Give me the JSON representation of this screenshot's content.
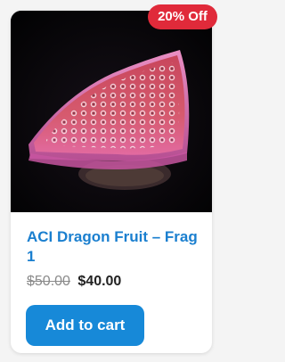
{
  "product": {
    "title": "ACI Dragon Fruit – Frag 1",
    "badge": "20% Off",
    "price_old": "$50.00",
    "price_new": "$40.00",
    "add_to_cart_label": "Add to cart",
    "image_alt": "coral-frag-photo"
  },
  "colors": {
    "badge_bg": "#e02a3a",
    "title_color": "#1a7fcf",
    "button_bg": "#1789d8",
    "coral_pink": "#d9566a",
    "coral_edge": "#e88bb6"
  }
}
